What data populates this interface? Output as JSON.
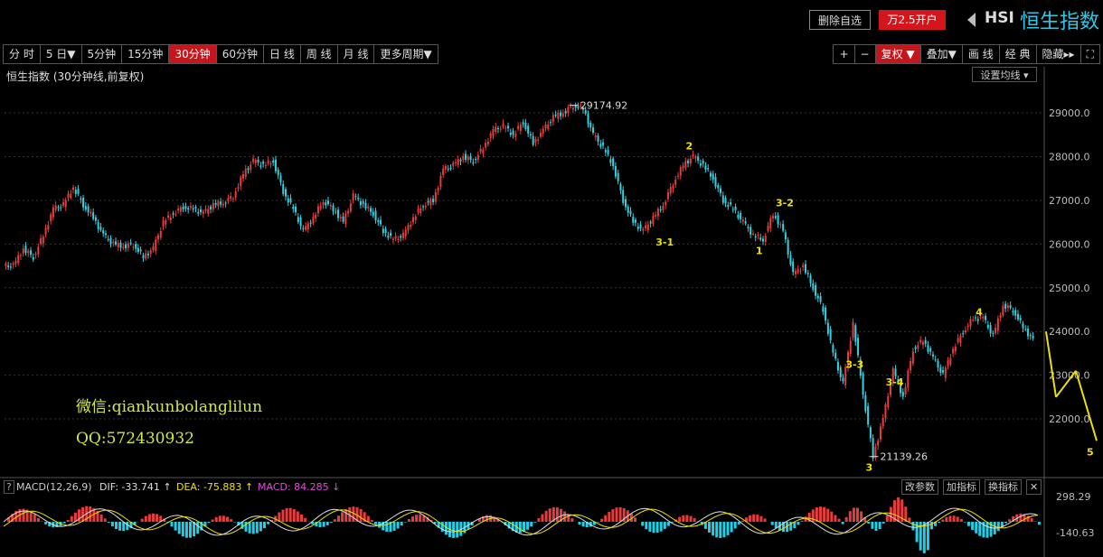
{
  "header": {
    "delete_label": "删除自选",
    "open_label": "万2.5开户",
    "code": "HSI",
    "name": "恒生指数"
  },
  "periods": [
    "分 时",
    "5 日▼",
    "5分钟",
    "15分钟",
    "30分钟",
    "60分钟",
    "日 线",
    "周 线",
    "月 线",
    "更多周期▼"
  ],
  "active_period": 4,
  "right_tools": [
    "+",
    "−",
    "复权 ▼",
    "叠加▼",
    "画 线",
    "经 典",
    "隐藏▸▸",
    "⛶"
  ],
  "active_tool": 2,
  "chart_title": "恒生指数 (30分钟线,前复权)",
  "ma_button": "设置均线 ▾",
  "watermark": {
    "wechat": "微信:qiankunbolanglilun",
    "qq": "QQ:572430932"
  },
  "macd": {
    "label": "MACD(12,26,9)",
    "dif": "DIF: -33.741 ↑",
    "dea": "DEA: -75.883 ↑",
    "macd": "MACD: 84.285 ↓",
    "buttons": [
      "改参数",
      "加指标",
      "换指标"
    ]
  },
  "colors": {
    "up": "#e83c3c",
    "down": "#35d0e0",
    "label": "#f0e000",
    "macd_up": "#e83c3c",
    "macd_down": "#20d0e8"
  },
  "chart_data": {
    "type": "line",
    "ylim": [
      20700,
      29600
    ],
    "yticks": [
      22000,
      23000,
      24000,
      25000,
      26000,
      27000,
      28000,
      29000
    ],
    "ytick_labels": [
      "22000.0",
      "23000.0",
      "24000.0",
      "25000.0",
      "26000.0",
      "27000.0",
      "28000.0",
      "29000.0"
    ],
    "series": [
      {
        "values": [
          25500,
          25900,
          25700,
          26200,
          26800,
          26900,
          27300,
          26900,
          26600,
          26200,
          26000,
          25950,
          26000,
          25700,
          25900,
          26500,
          26700,
          26850,
          26800,
          26700,
          26900,
          26950,
          27100,
          27600,
          27900,
          27800,
          27900,
          27200,
          26800,
          26300,
          26600,
          27000,
          26800,
          26500,
          27100,
          26900,
          26700,
          26300,
          26100,
          26200,
          26600,
          26900,
          27000,
          27700,
          27800,
          28000,
          27900,
          28200,
          28600,
          28700,
          28500,
          28800,
          28300,
          28600,
          28900,
          29000,
          29174,
          29100,
          28500,
          28200,
          27800,
          27000,
          26500,
          26300,
          26600,
          26900,
          27400,
          27800,
          28000,
          27800,
          27500,
          27000,
          26800,
          26500,
          26200,
          26100,
          26700,
          26300,
          25300,
          25500,
          25000,
          24500,
          23500,
          22800,
          24200,
          22600,
          21139,
          22000,
          23100,
          22500,
          23600,
          23800,
          23400,
          23000,
          23600,
          24000,
          24300,
          24300,
          23900,
          24600,
          24500,
          24100,
          23800
        ]
      }
    ],
    "annotations": [
      {
        "text": "29174.92",
        "x": 56,
        "y": 29174
      },
      {
        "text": "21139.26",
        "x": 86,
        "y": 21139
      },
      {
        "text": "1",
        "x": 75,
        "y": 26100
      },
      {
        "text": "2",
        "x": 68,
        "y": 28000
      },
      {
        "text": "3-1",
        "x": 65,
        "y": 26300
      },
      {
        "text": "3-2",
        "x": 77,
        "y": 26700
      },
      {
        "text": "3-3",
        "x": 84,
        "y": 23500
      },
      {
        "text": "3-4",
        "x": 88,
        "y": 23100
      },
      {
        "text": "3",
        "x": 86,
        "y": 21139
      },
      {
        "text": "4",
        "x": 97,
        "y": 24700
      },
      {
        "text": "5",
        "x": 106,
        "y": 21500
      }
    ],
    "macd_ticks": [
      "298.29",
      "-140.63"
    ]
  }
}
